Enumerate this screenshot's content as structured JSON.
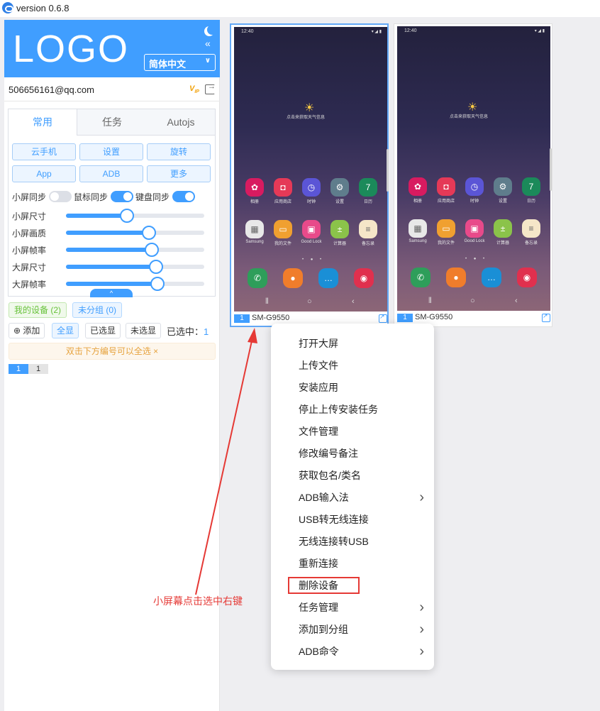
{
  "app": {
    "title": "version 0.6.8"
  },
  "sidebar": {
    "logo": "LOGO",
    "language": "简体中文",
    "email": "506656161@qq.com",
    "tabs": [
      "常用",
      "任务",
      "Autojs"
    ],
    "buttons_row1": [
      "云手机",
      "设置",
      "旋转"
    ],
    "buttons_row2": [
      "App",
      "ADB",
      "更多"
    ],
    "syncs": [
      {
        "label": "小屏同步",
        "on": false
      },
      {
        "label": "鼠标同步",
        "on": true
      },
      {
        "label": "键盘同步",
        "on": true
      }
    ],
    "sliders": [
      {
        "label": "小屏尺寸",
        "value": 0.44
      },
      {
        "label": "小屏画质",
        "value": 0.6
      },
      {
        "label": "小屏帧率",
        "value": 0.62
      },
      {
        "label": "大屏尺寸",
        "value": 0.65
      },
      {
        "label": "大屏帧率",
        "value": 0.66
      }
    ],
    "expand_label": "^",
    "groups": {
      "mine": "我的设备 (2)",
      "ungrouped": "未分组 (0)"
    },
    "actions": {
      "add": "添加",
      "show_all": "全显",
      "show_selected": "已选显",
      "show_unselected": "未选显"
    },
    "selected": {
      "label": "已选中：",
      "count": "1"
    },
    "hint": "双击下方编号可以全选 ×",
    "number_chips": [
      "1",
      "1"
    ]
  },
  "phones": [
    {
      "number": "1",
      "model": "SM-G9550",
      "time": "12:40",
      "status_icons": "▾ ◢ ▮",
      "weather_text": "点击来获取天气信息",
      "apps_row1": [
        {
          "label": "相册",
          "icon": "flower-icon",
          "color": "#d81b60",
          "glyph": "✿"
        },
        {
          "label": "应用商店",
          "icon": "bag-icon",
          "color": "#e53957",
          "glyph": "◘"
        },
        {
          "label": "时钟",
          "icon": "clock-icon",
          "color": "#5b55d6",
          "glyph": "◷"
        },
        {
          "label": "设置",
          "icon": "gear-icon",
          "color": "#5f7d8c",
          "glyph": "⚙"
        },
        {
          "label": "日历",
          "icon": "calendar-icon",
          "color": "#1b8a5a",
          "glyph": "7"
        }
      ],
      "apps_row2": [
        {
          "label": "Samsung",
          "icon": "folder-icon",
          "color": "#e8e8e8",
          "glyph": "▦"
        },
        {
          "label": "我的文件",
          "icon": "files-icon",
          "color": "#f0a030",
          "glyph": "▭"
        },
        {
          "label": "Good Lock",
          "icon": "goodlock-icon",
          "color": "#e84a8a",
          "glyph": "▣"
        },
        {
          "label": "计算器",
          "icon": "calculator-icon",
          "color": "#8bc34a",
          "glyph": "±"
        },
        {
          "label": "备忘录",
          "icon": "notes-icon",
          "color": "#f5e6c8",
          "glyph": "≡"
        }
      ],
      "dock": [
        {
          "icon": "phone-icon",
          "color": "#2e9e5a",
          "glyph": "✆"
        },
        {
          "icon": "contacts-icon",
          "color": "#f07d2b",
          "glyph": "●"
        },
        {
          "icon": "messages-icon",
          "color": "#1a8fd6",
          "glyph": "…"
        },
        {
          "icon": "camera-icon",
          "color": "#e0304e",
          "glyph": "◉"
        }
      ]
    },
    {
      "number": "1",
      "model": "SM-G9550",
      "time": "12:40",
      "status_icons": "▾ ◢ ▮",
      "weather_text": "点击来获取天气信息",
      "apps_row1": [
        {
          "label": "相册",
          "icon": "flower-icon",
          "color": "#d81b60",
          "glyph": "✿"
        },
        {
          "label": "应用商店",
          "icon": "bag-icon",
          "color": "#e53957",
          "glyph": "◘"
        },
        {
          "label": "时钟",
          "icon": "clock-icon",
          "color": "#5b55d6",
          "glyph": "◷"
        },
        {
          "label": "设置",
          "icon": "gear-icon",
          "color": "#5f7d8c",
          "glyph": "⚙"
        },
        {
          "label": "日历",
          "icon": "calendar-icon",
          "color": "#1b8a5a",
          "glyph": "7"
        }
      ],
      "apps_row2": [
        {
          "label": "Samsung",
          "icon": "folder-icon",
          "color": "#e8e8e8",
          "glyph": "▦"
        },
        {
          "label": "我的文件",
          "icon": "files-icon",
          "color": "#f0a030",
          "glyph": "▭"
        },
        {
          "label": "Good Lock",
          "icon": "goodlock-icon",
          "color": "#e84a8a",
          "glyph": "▣"
        },
        {
          "label": "计算器",
          "icon": "calculator-icon",
          "color": "#8bc34a",
          "glyph": "±"
        },
        {
          "label": "备忘录",
          "icon": "notes-icon",
          "color": "#f5e6c8",
          "glyph": "≡"
        }
      ],
      "dock": [
        {
          "icon": "phone-icon",
          "color": "#2e9e5a",
          "glyph": "✆"
        },
        {
          "icon": "contacts-icon",
          "color": "#f07d2b",
          "glyph": "●"
        },
        {
          "icon": "messages-icon",
          "color": "#1a8fd6",
          "glyph": "…"
        },
        {
          "icon": "camera-icon",
          "color": "#e0304e",
          "glyph": "◉"
        }
      ]
    }
  ],
  "context_menu": {
    "items": [
      {
        "label": "打开大屏",
        "submenu": false
      },
      {
        "label": "上传文件",
        "submenu": false
      },
      {
        "label": "安装应用",
        "submenu": false
      },
      {
        "label": "停止上传安装任务",
        "submenu": false
      },
      {
        "label": "文件管理",
        "submenu": false
      },
      {
        "label": "修改编号备注",
        "submenu": false
      },
      {
        "label": "获取包名/类名",
        "submenu": false
      },
      {
        "label": "ADB输入法",
        "submenu": true
      },
      {
        "label": "USB转无线连接",
        "submenu": false
      },
      {
        "label": "无线连接转USB",
        "submenu": false
      },
      {
        "label": "重新连接",
        "submenu": false
      },
      {
        "label": "删除设备",
        "submenu": false
      },
      {
        "label": "任务管理",
        "submenu": true
      },
      {
        "label": "添加到分组",
        "submenu": true
      },
      {
        "label": "ADB命令",
        "submenu": true
      }
    ]
  },
  "annotation": {
    "text": "小屏幕点击选中右键",
    "color": "#e53935"
  },
  "colors": {
    "primary": "#409eff",
    "annotation": "#e53935",
    "warning": "#e6a23c",
    "success": "#67c23a"
  }
}
